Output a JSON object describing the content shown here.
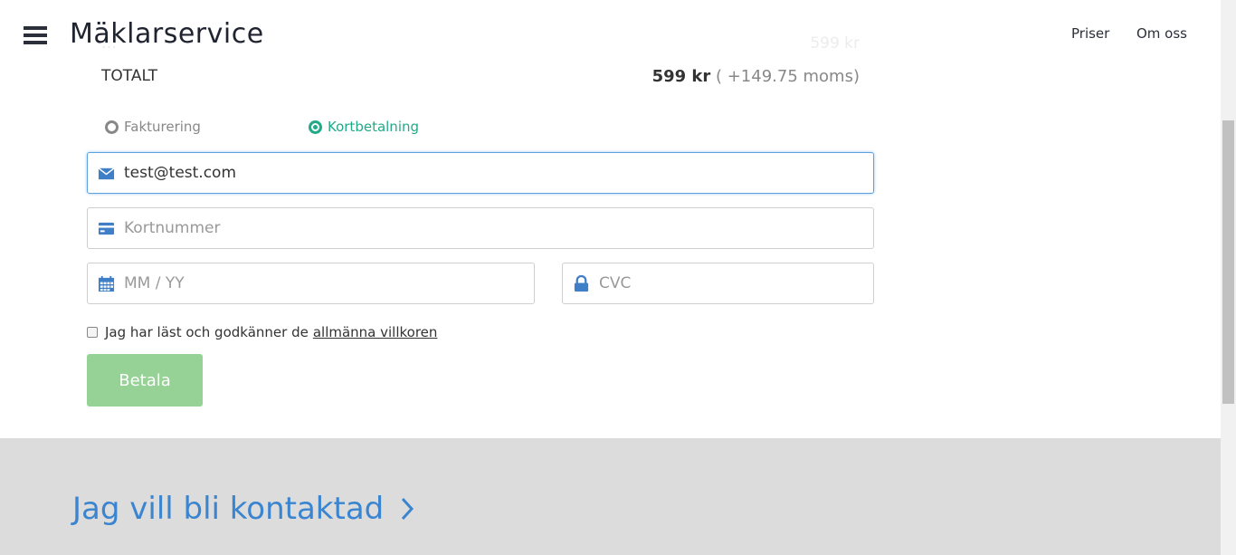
{
  "header": {
    "brand": "Mäklarservice",
    "nav": [
      "Priser",
      "Om oss"
    ]
  },
  "order": {
    "faded_left": "…",
    "faded_right": "599 kr",
    "total_label": "TOTALT",
    "total_price": "599 kr",
    "total_moms": "( +149.75 moms)"
  },
  "payment": {
    "options": [
      "Fakturering",
      "Kortbetalning"
    ],
    "selected": "Kortbetalning"
  },
  "form": {
    "email_value": "test@test.com",
    "card_placeholder": "Kortnummer",
    "expiry_placeholder": "MM / YY",
    "cvc_placeholder": "CVC",
    "terms_text": "Jag har läst och godkänner de",
    "terms_link": "allmänna villkoren",
    "pay_label": "Betala"
  },
  "footer": {
    "contact_label": "Jag vill bli kontaktad"
  },
  "colors": {
    "accent_green": "#22aa88",
    "pay_button": "#96d195",
    "link_blue": "#3a84d0",
    "icon_blue": "#3f7fc7"
  }
}
